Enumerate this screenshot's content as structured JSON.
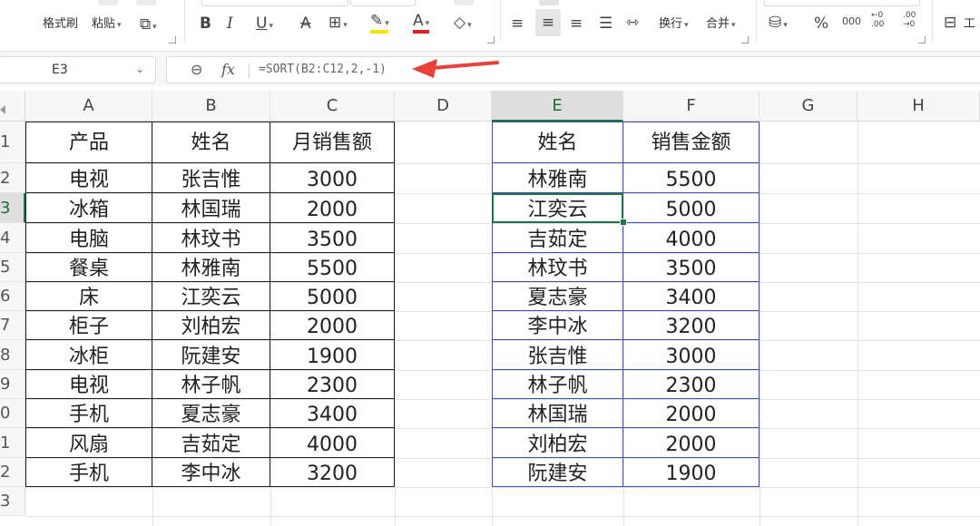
{
  "ribbon": {
    "format_painter": "格式刷",
    "paste": "粘贴",
    "copy_icon": "copy-icon",
    "bold": "B",
    "italic": "I",
    "underline": "U",
    "strikethrough": "A",
    "borders_icon": "borders-icon",
    "fill_icon": "fill-color-icon",
    "font_color": "A",
    "clear_icon": "eraser-icon",
    "wrap": "换行",
    "merge": "合并",
    "currency_icon": "currency-icon",
    "percent": "%",
    "thousands": "000",
    "inc_decimal": "←0 .00",
    "dec_decimal": ".00 →0",
    "worksheet": "工",
    "colors": {
      "font_color_bar": "#e02020",
      "fill_color_bar": "#f5e400"
    }
  },
  "formula_bar": {
    "cell_ref": "E3",
    "formula": "=SORT(B2:C12,2,-1)",
    "fx": "fx"
  },
  "sheet": {
    "columns": [
      "A",
      "B",
      "C",
      "D",
      "E",
      "F",
      "G",
      "H"
    ],
    "active_column": "E",
    "rows": [
      "1",
      "2",
      "3",
      "4",
      "5",
      "6",
      "7",
      "8",
      "9",
      "0",
      "1",
      "2",
      "3"
    ],
    "active_row_index": 2,
    "left_table": {
      "headers": [
        "产品",
        "姓名",
        "月销售额"
      ],
      "rows": [
        [
          "电视",
          "张吉惟",
          "3000"
        ],
        [
          "冰箱",
          "林国瑞",
          "2000"
        ],
        [
          "电脑",
          "林玟书",
          "3500"
        ],
        [
          "餐桌",
          "林雅南",
          "5500"
        ],
        [
          "床",
          "江奕云",
          "5000"
        ],
        [
          "柜子",
          "刘柏宏",
          "2000"
        ],
        [
          "冰柜",
          "阮建安",
          "1900"
        ],
        [
          "电视",
          "林子帆",
          "2300"
        ],
        [
          "手机",
          "夏志豪",
          "3400"
        ],
        [
          "风扇",
          "吉茹定",
          "4000"
        ],
        [
          "手机",
          "李中冰",
          "3200"
        ]
      ]
    },
    "right_table": {
      "headers": [
        "姓名",
        "销售金额"
      ],
      "rows": [
        [
          "林雅南",
          "5500"
        ],
        [
          "江奕云",
          "5000"
        ],
        [
          "吉茹定",
          "4000"
        ],
        [
          "林玟书",
          "3500"
        ],
        [
          "夏志豪",
          "3400"
        ],
        [
          "李中冰",
          "3200"
        ],
        [
          "张吉惟",
          "3000"
        ],
        [
          "林子帆",
          "2300"
        ],
        [
          "林国瑞",
          "2000"
        ],
        [
          "刘柏宏",
          "2000"
        ],
        [
          "阮建安",
          "1900"
        ]
      ]
    },
    "colors": {
      "selection": "#217346",
      "annotation_arrow": "#e8413a",
      "right_table_border": "#3a55a8"
    }
  }
}
